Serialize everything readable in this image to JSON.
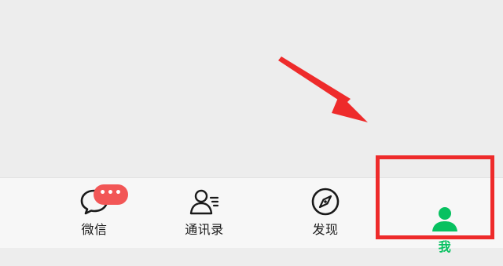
{
  "tabbar": {
    "tabs": [
      {
        "label": "微信",
        "icon": "chat-bubble-icon",
        "active": false,
        "badge": "•••"
      },
      {
        "label": "通讯录",
        "icon": "contacts-icon",
        "active": false
      },
      {
        "label": "发现",
        "icon": "compass-icon",
        "active": false
      },
      {
        "label": "我",
        "icon": "person-icon",
        "active": true
      }
    ]
  },
  "colors": {
    "active": "#07c160",
    "badge": "#f25656",
    "annotation": "#ee2b2b"
  }
}
